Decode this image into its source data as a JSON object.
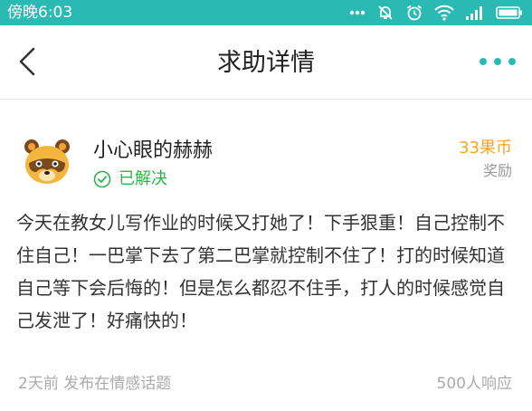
{
  "status_bar": {
    "time": "傍晚6:03",
    "icons": [
      "dots-icon",
      "mute-icon",
      "alarm-icon",
      "wifi-icon",
      "signal-icon",
      "battery-icon"
    ]
  },
  "nav": {
    "title": "求助详情",
    "back_icon": "chevron-left-icon",
    "more_icon": "more-dots-icon"
  },
  "post": {
    "username": "小心眼的赫赫",
    "status": "已解决",
    "reward_amount": "33果币",
    "reward_label": "奖励",
    "content": "今天在教女儿写作业的时候又打她了！下手狠重！自己控制不住自己！一巴掌下去了第二巴掌就控制不住了！打的时候知道自己等下会后悔的！但是怎么都忍不住手，打人的时候感觉自己发泄了！好痛快的！",
    "posted_info": "2天前 发布在情感话题",
    "responses": "500人响应"
  },
  "colors": {
    "accent": "#2bb9b4",
    "solved": "#2bb54a",
    "reward": "#f5a623"
  }
}
